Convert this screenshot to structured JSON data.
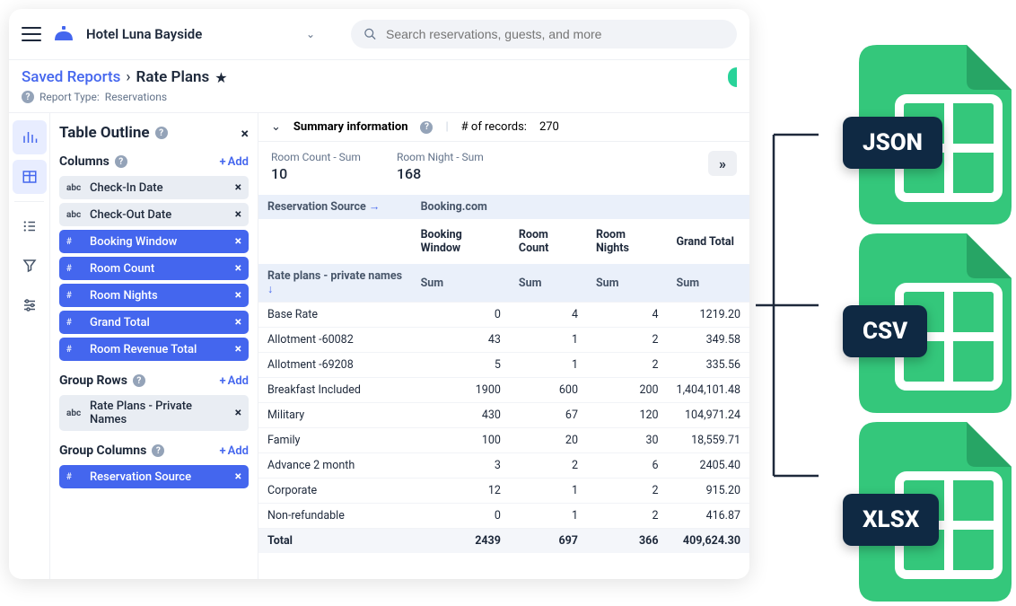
{
  "header": {
    "hotel_name": "Hotel Luna Bayside",
    "search_placeholder": "Search reservations, guests, and more"
  },
  "breadcrumb": {
    "link": "Saved Reports",
    "sep": "›",
    "current": "Rate Plans",
    "report_type_label": "Report Type:",
    "report_type_value": "Reservations"
  },
  "outline": {
    "title": "Table Outline",
    "columns_label": "Columns",
    "group_rows_label": "Group Rows",
    "group_columns_label": "Group Columns",
    "add_label": "Add",
    "columns": [
      {
        "type": "abc",
        "label": "Check-In Date",
        "variant": "gray"
      },
      {
        "type": "abc",
        "label": "Check-Out Date",
        "variant": "gray"
      },
      {
        "type": "#",
        "label": "Booking Window",
        "variant": "blue"
      },
      {
        "type": "#",
        "label": "Room Count",
        "variant": "blue"
      },
      {
        "type": "#",
        "label": "Room Nights",
        "variant": "blue"
      },
      {
        "type": "#",
        "label": "Grand Total",
        "variant": "blue"
      },
      {
        "type": "#",
        "label": "Room Revenue Total",
        "variant": "blue"
      }
    ],
    "group_rows": [
      {
        "type": "abc",
        "label": "Rate Plans - Private Names",
        "variant": "gray"
      }
    ],
    "group_columns": [
      {
        "type": "#",
        "label": "Reservation Source",
        "variant": "blue"
      }
    ]
  },
  "summary": {
    "title": "Summary information",
    "records_label": "# of records:",
    "records_value": "270",
    "metrics": [
      {
        "label": "Room Count - Sum",
        "value": "10"
      },
      {
        "label": "Room Night - Sum",
        "value": "168"
      }
    ]
  },
  "table": {
    "source_label": "Reservation Source",
    "source_value": "Booking.com",
    "col_headers": [
      "Booking Window",
      "Room Count",
      "Room Nights",
      "Grand Total"
    ],
    "row_dim_label": "Rate plans - private names",
    "agg_label": "Sum",
    "rows": [
      {
        "name": "Base Rate",
        "bw": "0",
        "rc": "4",
        "rn": "4",
        "gt": "1219.20"
      },
      {
        "name": "Allotment -60082",
        "bw": "43",
        "rc": "1",
        "rn": "2",
        "gt": "349.58"
      },
      {
        "name": "Allotment -69208",
        "bw": "5",
        "rc": "1",
        "rn": "2",
        "gt": "335.56"
      },
      {
        "name": "Breakfast Included",
        "bw": "1900",
        "rc": "600",
        "rn": "200",
        "gt": "1,404,101.48"
      },
      {
        "name": "Military",
        "bw": "430",
        "rc": "67",
        "rn": "120",
        "gt": "104,971.24"
      },
      {
        "name": "Family",
        "bw": "100",
        "rc": "20",
        "rn": "30",
        "gt": "18,559.71"
      },
      {
        "name": "Advance 2 month",
        "bw": "3",
        "rc": "2",
        "rn": "6",
        "gt": "2405.40"
      },
      {
        "name": "Corporate",
        "bw": "12",
        "rc": "1",
        "rn": "2",
        "gt": "915.20"
      },
      {
        "name": "Non-refundable",
        "bw": "0",
        "rc": "1",
        "rn": "2",
        "gt": "416.87"
      }
    ],
    "total": {
      "name": "Total",
      "bw": "2439",
      "rc": "697",
      "rn": "366",
      "gt": "409,624.30"
    }
  },
  "exports": {
    "formats": [
      "JSON",
      "CSV",
      "XLSX"
    ]
  },
  "colors": {
    "primary": "#4466ee",
    "green": "#34c77b",
    "navy": "#0f2943"
  }
}
